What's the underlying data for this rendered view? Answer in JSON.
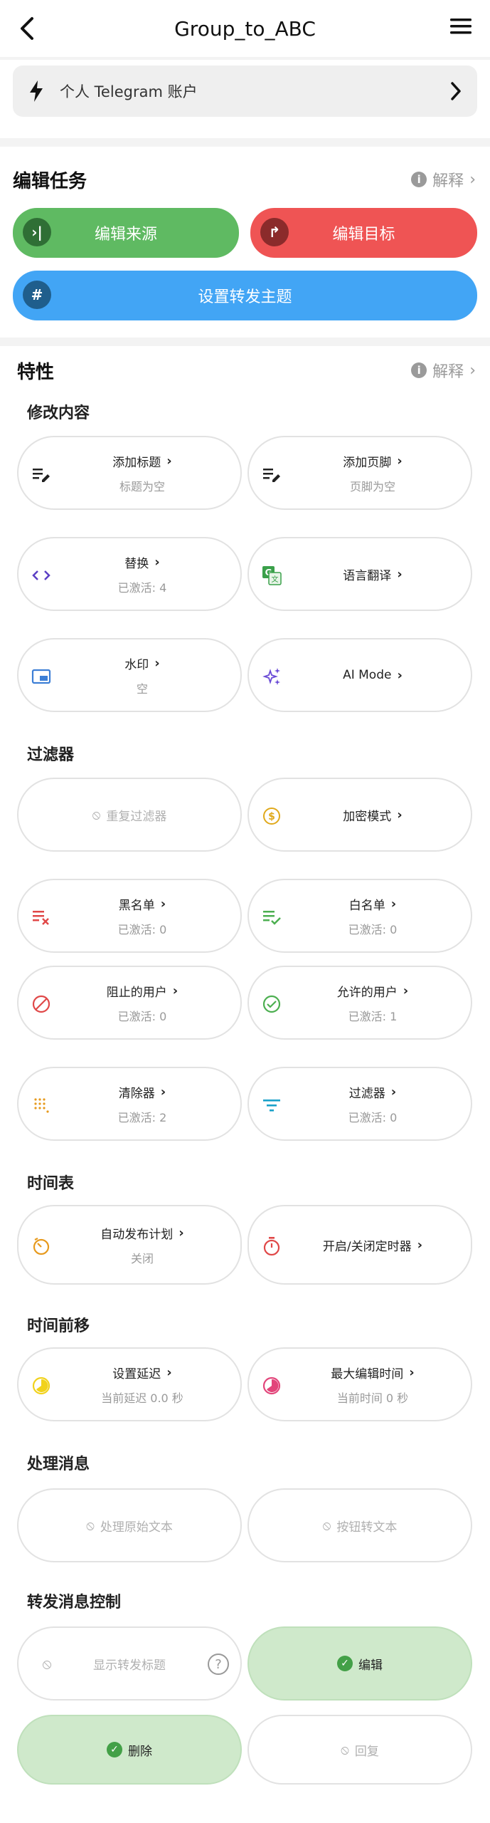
{
  "header": {
    "title": "Group_to_ABC"
  },
  "account": {
    "label": "个人 Telegram 账户"
  },
  "edit_task": {
    "title": "编辑任务",
    "explain": "解释",
    "source_label": "编辑来源",
    "target_label": "编辑目标",
    "topic_label": "设置转发主题"
  },
  "features": {
    "title": "特性",
    "explain": "解释",
    "modify": {
      "title": "修改内容",
      "add_header": {
        "name": "添加标题",
        "value": "标题为空"
      },
      "add_footer": {
        "name": "添加页脚",
        "value": "页脚为空"
      },
      "replace": {
        "name": "替换",
        "value": "已激活: 4"
      },
      "translate": {
        "name": "语言翻译"
      },
      "watermark": {
        "name": "水印",
        "value": "空"
      },
      "ai_mode": {
        "name": "AI Mode"
      }
    },
    "filters": {
      "title": "过滤器",
      "duplicate": {
        "name": "重复过滤器"
      },
      "crypto": {
        "name": "加密模式"
      },
      "blacklist": {
        "name": "黑名单",
        "value": "已激活: 0"
      },
      "whitelist": {
        "name": "白名单",
        "value": "已激活: 0"
      },
      "blocked_users": {
        "name": "阻止的用户",
        "value": "已激活: 0"
      },
      "allowed_users": {
        "name": "允许的用户",
        "value": "已激活: 1"
      },
      "cleaner": {
        "name": "清除器",
        "value": "已激活: 2"
      },
      "filter": {
        "name": "过滤器",
        "value": "已激活: 0"
      }
    },
    "schedule": {
      "title": "时间表",
      "auto_post": {
        "name": "自动发布计划",
        "value": "关闭"
      },
      "timer": {
        "name": "开启/关闭定时器"
      }
    },
    "time_shift": {
      "title": "时间前移",
      "delay": {
        "name": "设置延迟",
        "value": "当前延迟 0.0 秒"
      },
      "max_edit": {
        "name": "最大编辑时间",
        "value": "当前时间 0 秒"
      }
    },
    "process": {
      "title": "处理消息",
      "raw_text": {
        "name": "处理原始文本"
      },
      "button_text": {
        "name": "按钮转文本"
      }
    },
    "forward_control": {
      "title": "转发消息控制",
      "show_header": {
        "name": "显示转发标题"
      },
      "edit": {
        "name": "编辑"
      },
      "delete": {
        "name": "删除"
      },
      "reply": {
        "name": "回复"
      }
    }
  },
  "colors": {
    "green": "#5fba62",
    "red": "#ef5454",
    "blue": "#42a5f5",
    "light_green": "#cfe9cb"
  }
}
